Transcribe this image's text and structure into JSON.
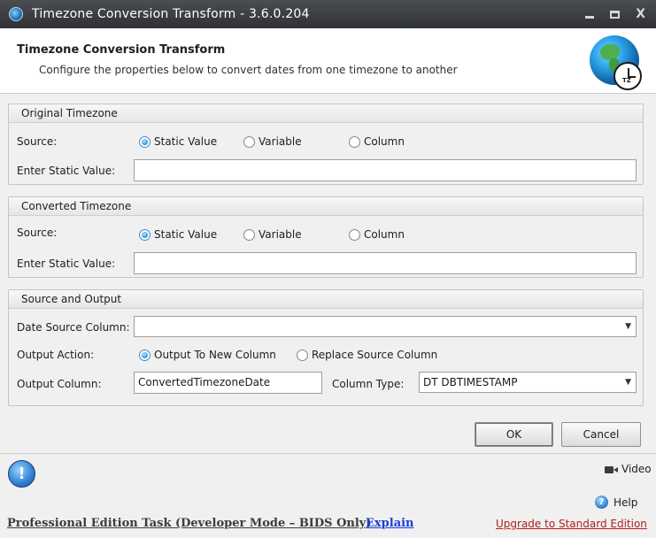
{
  "window": {
    "title": "Timezone Conversion Transform - 3.6.0.204",
    "min_icon": "minimize-icon",
    "max_icon": "maximize-icon",
    "close_glyph": "X"
  },
  "header": {
    "title": "Timezone Conversion Transform",
    "subtitle": "Configure the properties below to convert dates from one timezone to another",
    "badge": "TZ"
  },
  "original_timezone": {
    "group_label": "Original Timezone",
    "source_label": "Source:",
    "options": [
      "Static Value",
      "Variable",
      "Column"
    ],
    "selected": "Static Value",
    "static_label": "Enter Static Value:",
    "static_value": ""
  },
  "converted_timezone": {
    "group_label": "Converted Timezone",
    "source_label": "Source:",
    "options": [
      "Static Value",
      "Variable",
      "Column"
    ],
    "selected": "Static Value",
    "static_label": "Enter Static Value:",
    "static_value": ""
  },
  "source_output": {
    "group_label": "Source and Output",
    "date_source_label": "Date Source Column:",
    "date_source_value": "",
    "output_action_label": "Output Action:",
    "output_actions": [
      "Output To New Column",
      "Replace Source Column"
    ],
    "selected_action": "Output To New Column",
    "output_column_label": "Output Column:",
    "output_column_value": "ConvertedTimezoneDate",
    "column_type_label": "Column Type:",
    "column_type_value": "DT DBTIMESTAMP"
  },
  "buttons": {
    "ok": "OK",
    "cancel": "Cancel"
  },
  "footer": {
    "info_glyph": "!",
    "video_label": "Video",
    "help_label": "Help",
    "help_glyph": "?",
    "edition_text": "Professional Edition Task (Developer Mode – BIDS Only)",
    "explain_link": "Explain",
    "upgrade_link": "Upgrade to Standard Edition"
  },
  "colors": {
    "titlebar": "#3a3c40",
    "link_blue": "#1a3fd9",
    "link_red": "#b01e1e",
    "radio_selected": "#2d8fd8"
  }
}
